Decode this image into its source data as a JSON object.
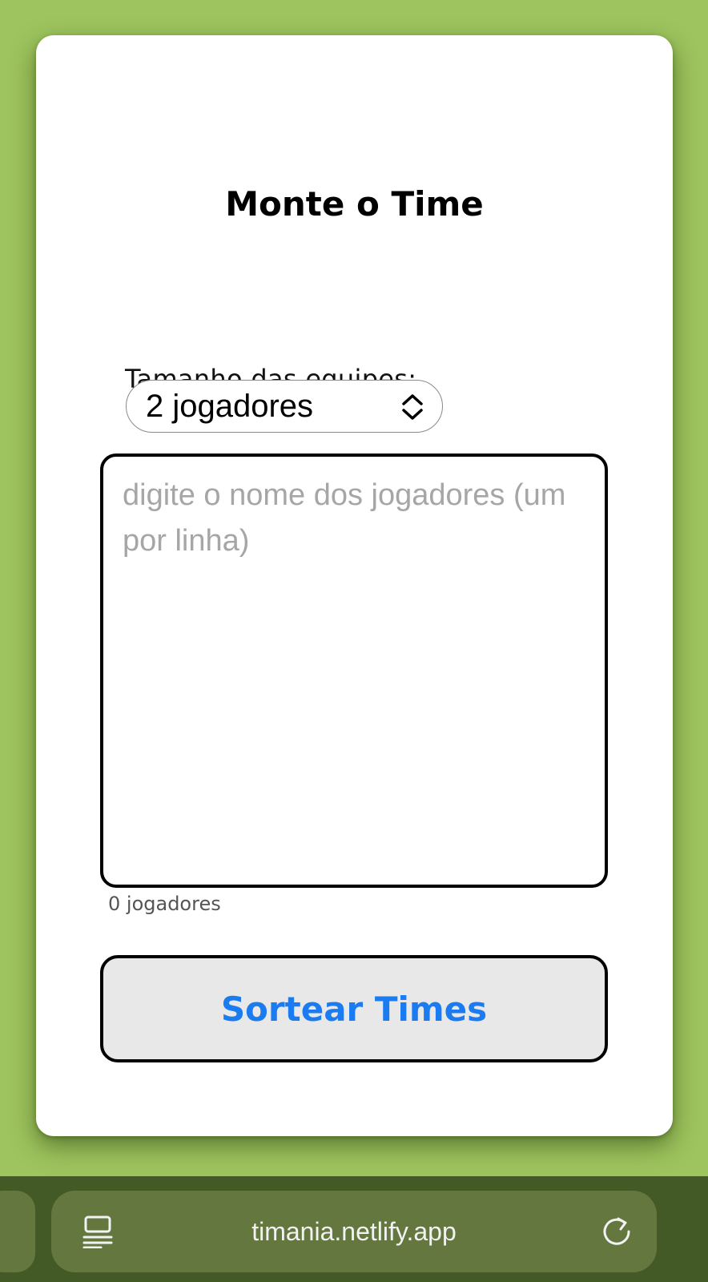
{
  "page": {
    "title": "Monte o Time"
  },
  "form": {
    "team_size_label": "Tamanho das equipes:",
    "team_size_selected": "2 jogadores",
    "players_placeholder": "digite o nome dos jogadores (um por linha)",
    "players_count": "0 jogadores",
    "submit_label": "Sortear Times"
  },
  "browser": {
    "url": "timania.netlify.app",
    "icons": [
      "reader-mode-icon",
      "reload-icon"
    ]
  },
  "colors": {
    "background": "#9dc45e",
    "accent": "#1a7cf0",
    "toolbar": "#445a26"
  }
}
